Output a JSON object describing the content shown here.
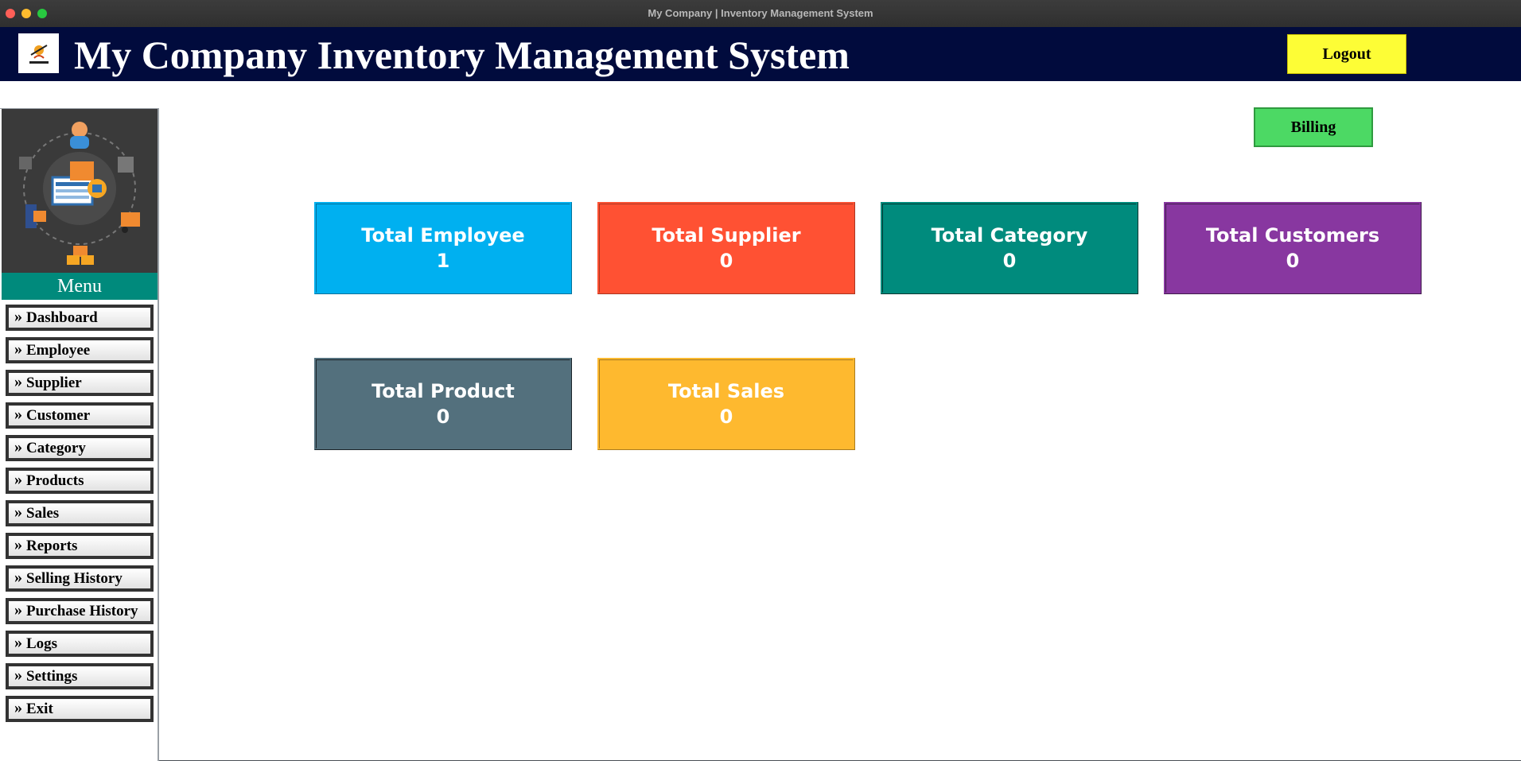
{
  "window": {
    "title": "My Company | Inventory Management System"
  },
  "header": {
    "title": "My Company Inventory Management System",
    "logout_label": "Logout"
  },
  "sidebar": {
    "menu_heading": "Menu",
    "items": [
      {
        "label": "Dashboard"
      },
      {
        "label": "Employee"
      },
      {
        "label": "Supplier"
      },
      {
        "label": "Customer"
      },
      {
        "label": "Category"
      },
      {
        "label": "Products"
      },
      {
        "label": "Sales"
      },
      {
        "label": "Reports"
      },
      {
        "label": "Selling History"
      },
      {
        "label": "Purchase History"
      },
      {
        "label": "Logs"
      },
      {
        "label": "Settings"
      },
      {
        "label": "Exit"
      }
    ]
  },
  "main": {
    "billing_label": "Billing",
    "stats": [
      {
        "title": "Total Employee",
        "value": "1",
        "color": "#00b0f0"
      },
      {
        "title": "Total Supplier",
        "value": "0",
        "color": "#ff5133"
      },
      {
        "title": "Total Category",
        "value": "0",
        "color": "#008b7d"
      },
      {
        "title": "Total Customers",
        "value": "0",
        "color": "#8837a0"
      },
      {
        "title": "Total Product",
        "value": "0",
        "color": "#53707d"
      },
      {
        "title": "Total Sales",
        "value": "0",
        "color": "#feb92f"
      }
    ]
  }
}
